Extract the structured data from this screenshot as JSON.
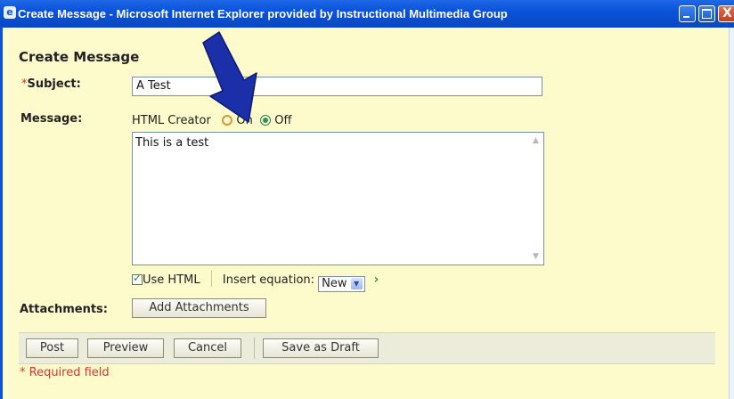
{
  "window": {
    "title": "Create Message - Microsoft Internet Explorer provided by Instructional Multimedia Group",
    "minimize_icon": "minimize-icon",
    "maximize_icon": "maximize-icon",
    "close_icon": "close-icon",
    "close_glyph": "X"
  },
  "form": {
    "section_title": "Create Message",
    "subject_required_mark": "*",
    "subject_label": "Subject:",
    "subject_value": "A Test",
    "message_label": "Message:",
    "html_creator_label": "HTML Creator",
    "html_creator_options": [
      "On",
      "Off"
    ],
    "html_creator_selected": "Off",
    "message_text": "This is a test",
    "use_html_label": "Use HTML",
    "use_html_checked": true,
    "insert_equation_label": "Insert equation:",
    "insert_equation_value": "New",
    "attachments_label": "Attachments:",
    "add_attachments_label": "Add Attachments"
  },
  "actions": {
    "post": "Post",
    "preview": "Preview",
    "cancel": "Cancel",
    "save_draft": "Save as Draft"
  },
  "footer": {
    "required_note": "* Required field"
  },
  "colors": {
    "panel_bg": "#fdfbcc",
    "title_bar": "#0a53d8",
    "required": "#dd3333",
    "annotation_arrow": "#1a2fa8"
  }
}
